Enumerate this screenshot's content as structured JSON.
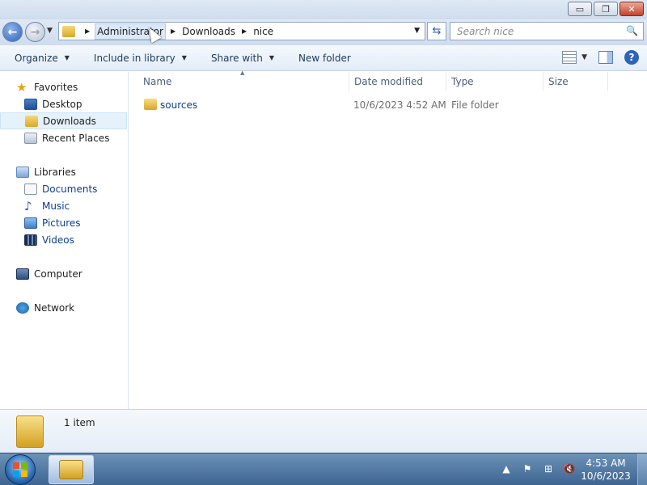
{
  "window": {
    "controls": {
      "minimize": "▭",
      "maximize": "❐",
      "close": "✕"
    }
  },
  "navigation": {
    "back_glyph": "←",
    "forward_glyph": "→",
    "recent_glyph": "▼",
    "refresh_glyph": "⇆",
    "breadcrumb": [
      "Administrator",
      "Downloads",
      "nice"
    ],
    "crumb_separator": "▶",
    "address_dropdown_glyph": "▼"
  },
  "search": {
    "placeholder": "Search nice",
    "icon_glyph": "🔍"
  },
  "toolbar": {
    "items": [
      {
        "label": "Organize",
        "arrow": "▼"
      },
      {
        "label": "Include in library",
        "arrow": "▼"
      },
      {
        "label": "Share with",
        "arrow": "▼"
      },
      {
        "label": "New folder",
        "arrow": ""
      }
    ],
    "view_dropdown_glyph": "▼",
    "help_glyph": "?"
  },
  "sidebar": {
    "favorites": {
      "label": "Favorites",
      "icon_glyph": "★",
      "items": [
        "Desktop",
        "Downloads",
        "Recent Places"
      ]
    },
    "libraries": {
      "label": "Libraries",
      "items": [
        "Documents",
        "Music",
        "Pictures",
        "Videos"
      ],
      "music_glyph": "♪"
    },
    "computer": {
      "label": "Computer"
    },
    "network": {
      "label": "Network"
    },
    "selected": "Downloads"
  },
  "columns": {
    "name": "Name",
    "date_modified": "Date modified",
    "type": "Type",
    "size": "Size",
    "sort_glyph": "▲"
  },
  "files": [
    {
      "name": "sources",
      "date_modified": "10/6/2023 4:52 AM",
      "type": "File folder",
      "size": ""
    }
  ],
  "details": {
    "item_count": "1 item"
  },
  "taskbar": {
    "tray": {
      "show_hidden_glyph": "▲",
      "flag_glyph": "⚑",
      "network_glyph": "⊞",
      "volume_glyph": "🔇"
    },
    "clock": {
      "time": "4:53 AM",
      "date": "10/6/2023"
    }
  }
}
